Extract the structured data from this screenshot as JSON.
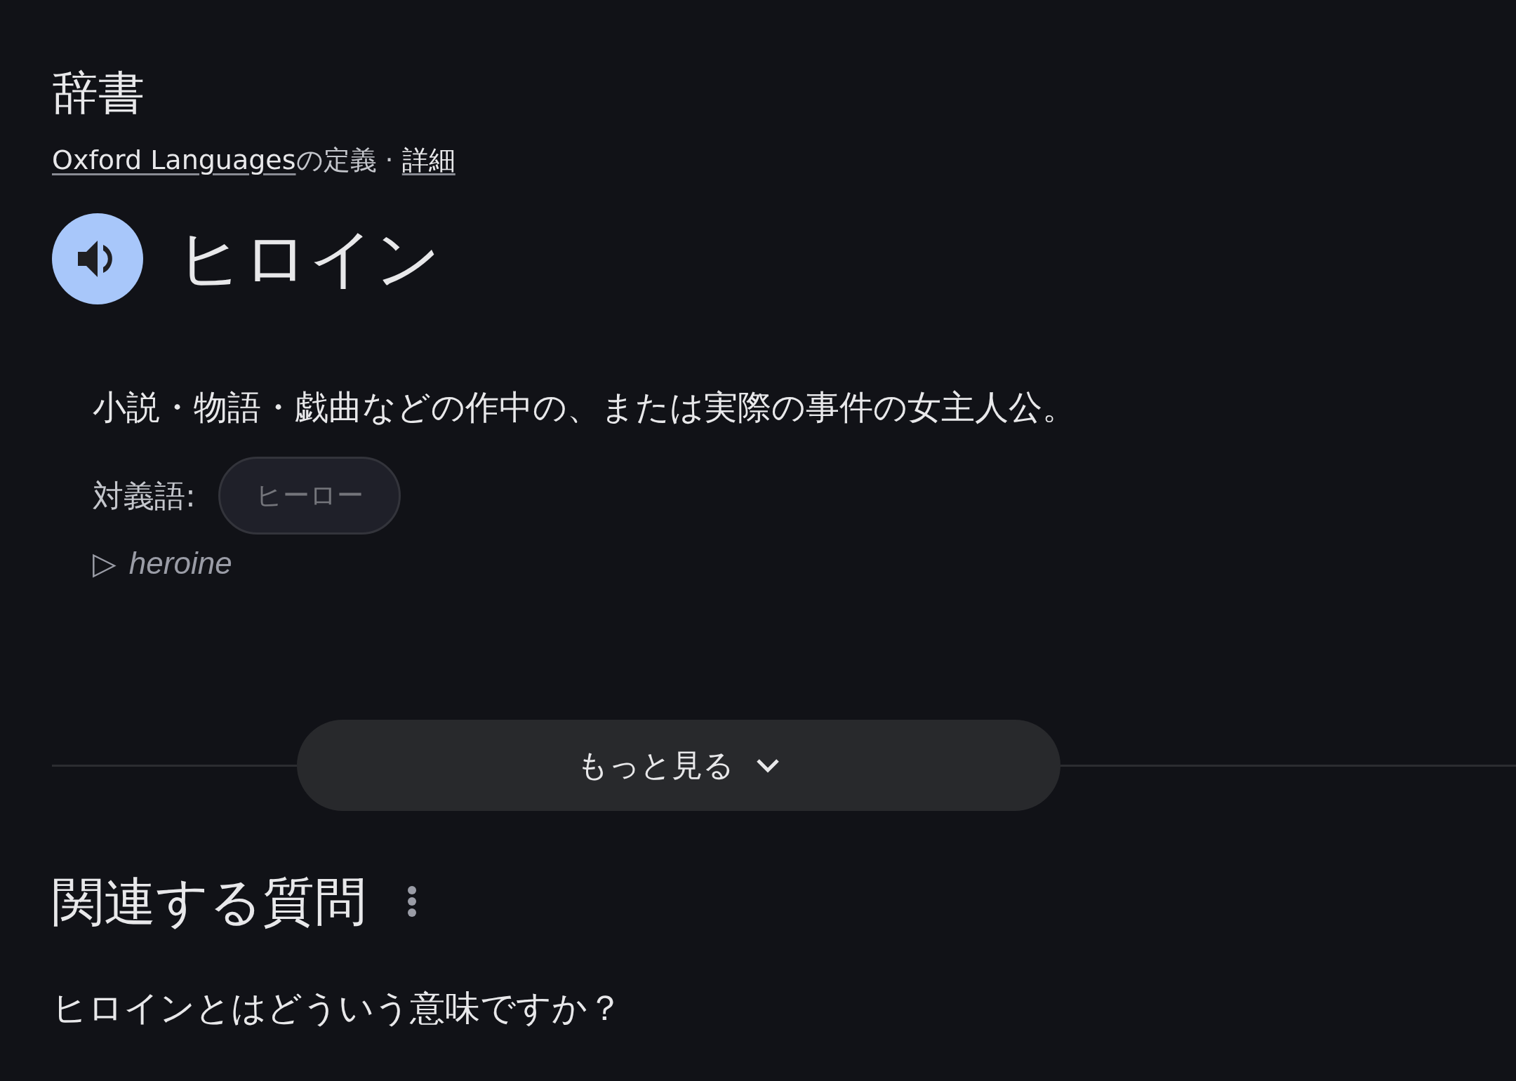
{
  "title": "辞書",
  "source": {
    "link": "Oxford Languages",
    "suffix": "の定義",
    "separator": "·",
    "details": "詳細"
  },
  "entry": {
    "word": "ヒロイン",
    "definition": "小説・物語・戯曲などの作中の、または実際の事件の女主人公。",
    "antonym_label": "対義語:",
    "antonyms": [
      "ヒーロー"
    ],
    "origin": {
      "marker": "▷",
      "text": "heroine"
    }
  },
  "more_button": "もっと見る",
  "related": {
    "title": "関連する質問",
    "questions": [
      "ヒロインとはどういう意味ですか？"
    ]
  }
}
